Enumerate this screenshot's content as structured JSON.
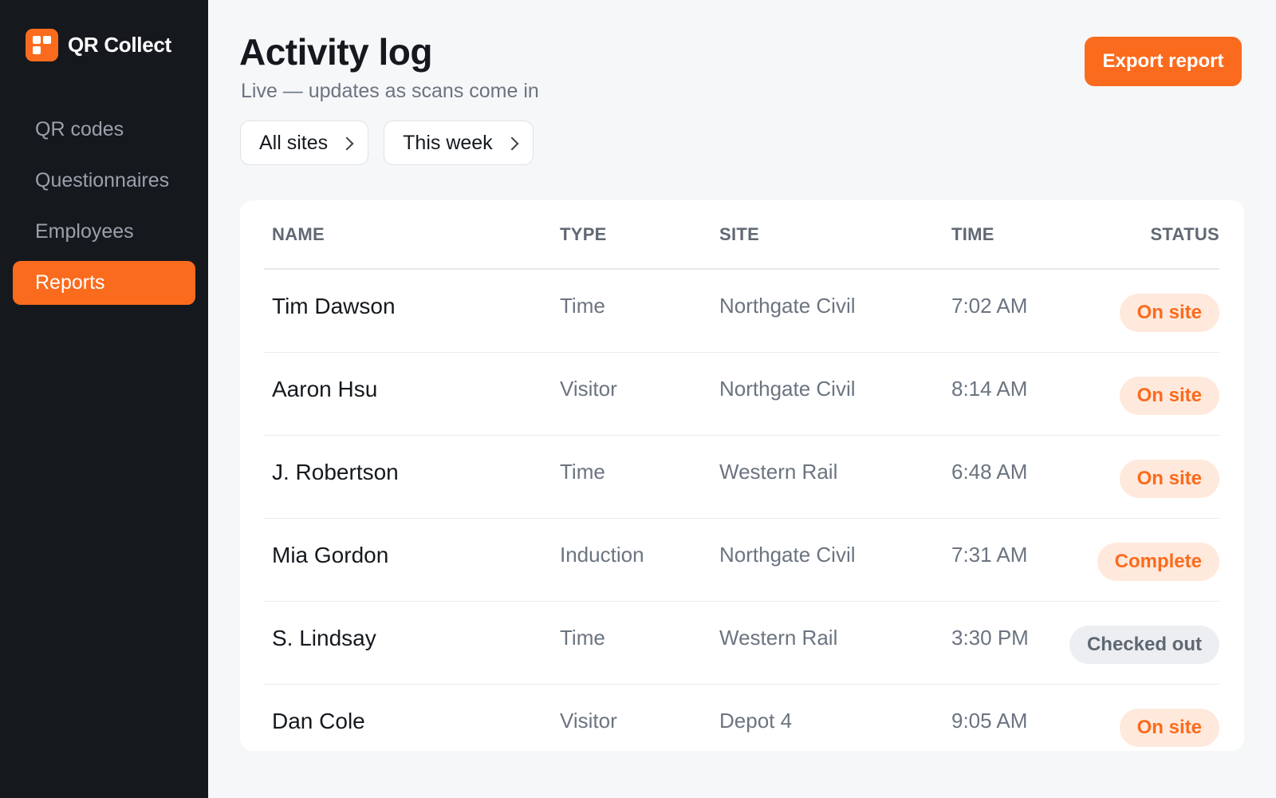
{
  "app": {
    "name": "QR Collect"
  },
  "sidebar": {
    "items": [
      {
        "label": "QR codes",
        "active": false
      },
      {
        "label": "Questionnaires",
        "active": false
      },
      {
        "label": "Employees",
        "active": false
      },
      {
        "label": "Reports",
        "active": true
      }
    ]
  },
  "header": {
    "title": "Activity log",
    "subtitle": "Live — updates as scans come in",
    "export_label": "Export report"
  },
  "filters": [
    {
      "label": "All sites"
    },
    {
      "label": "This week"
    }
  ],
  "table": {
    "columns": [
      "NAME",
      "TYPE",
      "SITE",
      "TIME",
      "STATUS"
    ],
    "rows": [
      {
        "name": "Tim Dawson",
        "type": "Time",
        "site": "Northgate Civil",
        "time": "7:02 AM",
        "status": "On site",
        "tone": "orange"
      },
      {
        "name": "Aaron Hsu",
        "type": "Visitor",
        "site": "Northgate Civil",
        "time": "8:14 AM",
        "status": "On site",
        "tone": "orange"
      },
      {
        "name": "J. Robertson",
        "type": "Time",
        "site": "Western Rail",
        "time": "6:48 AM",
        "status": "On site",
        "tone": "orange"
      },
      {
        "name": "Mia Gordon",
        "type": "Induction",
        "site": "Northgate Civil",
        "time": "7:31 AM",
        "status": "Complete",
        "tone": "orange"
      },
      {
        "name": "S. Lindsay",
        "type": "Time",
        "site": "Western Rail",
        "time": "3:30 PM",
        "status": "Checked out",
        "tone": "gray"
      },
      {
        "name": "Dan Cole",
        "type": "Visitor",
        "site": "Depot 4",
        "time": "9:05 AM",
        "status": "On site",
        "tone": "orange"
      }
    ]
  },
  "colors": {
    "accent": "#fb6b1d",
    "sidebar_bg": "#15191e",
    "badge_orange_bg": "#ffe9dc",
    "badge_gray_bg": "#eceef1"
  },
  "icons": {
    "logo": "qr-grid-icon",
    "filter_chevron": "chevron-right-icon"
  }
}
